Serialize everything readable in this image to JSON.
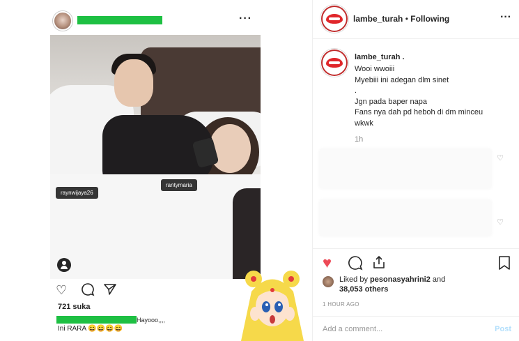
{
  "left_post": {
    "tags": [
      "raynwijaya26",
      "rantymaria"
    ],
    "likes": "721 suka",
    "caption_suffix": "Hayooo,,,,",
    "caption_line2": "Ini RARA 😄😄😄😄",
    "icons": [
      "heart-outline-icon",
      "comment-icon",
      "share-icon",
      "user-tag-icon",
      "more-icon"
    ]
  },
  "right_panel": {
    "header": {
      "username": "lambe_turah",
      "separator": "•",
      "follow_label": "Following",
      "more": "···"
    },
    "caption": {
      "username": "lambe_turah .",
      "lines": [
        "Wooi wwoiii",
        "Myebiii ini adegan dlm sinet",
        ".",
        "Jgn pada baper napa",
        "Fans nya dah pd heboh di dm minceu",
        "wkwk"
      ],
      "time": "1h"
    },
    "liked_by": {
      "prefix": "Liked by ",
      "user": "pesonasyahrini2",
      "mid": " and",
      "count": "38,053 others"
    },
    "posted": "1 HOUR AGO",
    "comment": {
      "placeholder": "Add a comment...",
      "post_label": "Post"
    },
    "colors": {
      "heart": "#ed4956",
      "post_disabled": "#b2dffc",
      "censor": "#1ec043"
    }
  }
}
